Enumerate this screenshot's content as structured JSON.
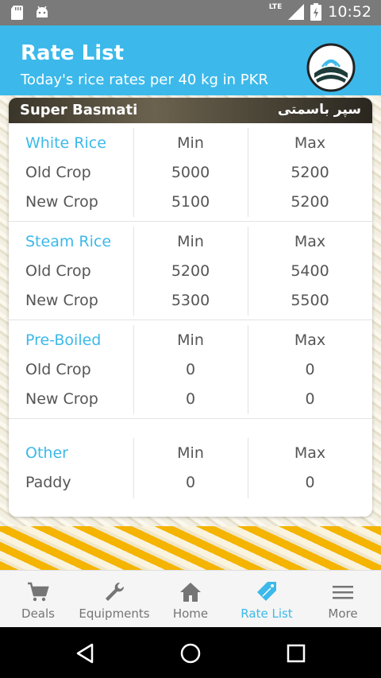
{
  "status_bar": {
    "time": "10:52",
    "network": "LTE",
    "icons": [
      "sd-card-icon",
      "android-icon",
      "signal-icon",
      "battery-icon"
    ]
  },
  "header": {
    "title": "Rate List",
    "subtitle": "Today's rice rates per 40 kg in PKR",
    "color": "#3cb9ea"
  },
  "card": {
    "title": "Super Basmati",
    "title_urdu": "سپر باسمتی",
    "sections": [
      {
        "category": "White Rice",
        "min_label": "Min",
        "max_label": "Max",
        "rows": [
          {
            "label": "Old Crop",
            "min": "5000",
            "max": "5200"
          },
          {
            "label": "New Crop",
            "min": "5100",
            "max": "5200"
          }
        ]
      },
      {
        "category": "Steam Rice",
        "min_label": "Min",
        "max_label": "Max",
        "rows": [
          {
            "label": "Old Crop",
            "min": "5200",
            "max": "5400"
          },
          {
            "label": "New Crop",
            "min": "5300",
            "max": "5500"
          }
        ]
      },
      {
        "category": "Pre-Boiled",
        "min_label": "Min",
        "max_label": "Max",
        "rows": [
          {
            "label": "Old Crop",
            "min": "0",
            "max": "0"
          },
          {
            "label": "New Crop",
            "min": "0",
            "max": "0"
          }
        ]
      },
      {
        "category": "Other",
        "min_label": "Min",
        "max_label": "Max",
        "rows": [
          {
            "label": "Paddy",
            "min": "0",
            "max": "0"
          }
        ]
      }
    ]
  },
  "bottom_nav": {
    "items": [
      {
        "label": "Deals",
        "icon": "cart-icon"
      },
      {
        "label": "Equipments",
        "icon": "wrench-icon"
      },
      {
        "label": "Home",
        "icon": "home-icon"
      },
      {
        "label": "Rate List",
        "icon": "tag-icon",
        "active": true
      },
      {
        "label": "More",
        "icon": "menu-icon"
      }
    ],
    "active_color": "#3cb9ea"
  }
}
